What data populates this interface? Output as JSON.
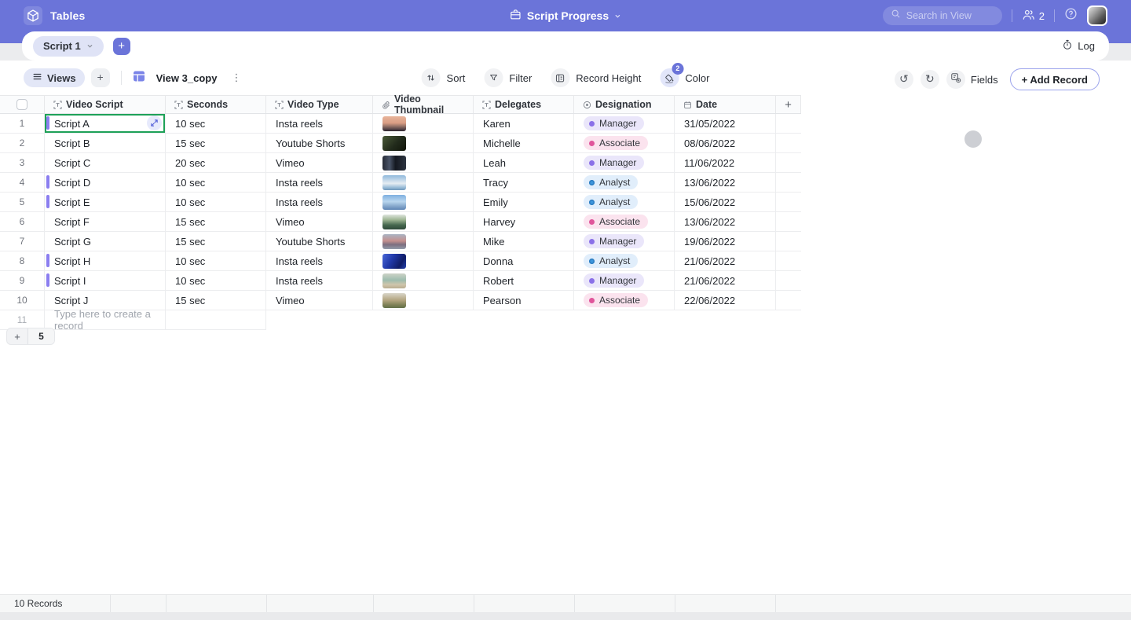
{
  "topbar": {
    "app_name": "Tables",
    "title": "Script Progress",
    "search_placeholder": "Search in View",
    "collaborator_count": "2"
  },
  "tabs": {
    "active_tab": "Script 1",
    "log_label": "Log"
  },
  "toolbar": {
    "views_label": "Views",
    "view_name": "View 3_copy",
    "sort_label": "Sort",
    "filter_label": "Filter",
    "record_height_label": "Record Height",
    "color_label": "Color",
    "color_badge": "2",
    "fields_label": "Fields",
    "add_record_label": "+ Add Record"
  },
  "table": {
    "columns": [
      {
        "label": "Video Script",
        "icon": "text-field-icon"
      },
      {
        "label": "Seconds",
        "icon": "text-field-icon"
      },
      {
        "label": "Video Type",
        "icon": "text-field-icon"
      },
      {
        "label": "Video Thumbnail",
        "icon": "attachment-icon"
      },
      {
        "label": "Delegates",
        "icon": "text-field-icon"
      },
      {
        "label": "Designation",
        "icon": "select-icon"
      },
      {
        "label": "Date",
        "icon": "date-icon"
      }
    ],
    "rows": [
      {
        "num": "1",
        "script": "Script A",
        "seconds": "10 sec",
        "type": "Insta reels",
        "delegate": "Karen",
        "designation": "Manager",
        "date": "31/05/2022",
        "accent": true,
        "selected": true,
        "thumb": "thumb-1"
      },
      {
        "num": "2",
        "script": "Script B",
        "seconds": "15 sec",
        "type": "Youtube Shorts",
        "delegate": "Michelle",
        "designation": "Associate",
        "date": "08/06/2022",
        "accent": false,
        "selected": false,
        "thumb": "thumb-2"
      },
      {
        "num": "3",
        "script": "Script C",
        "seconds": "20 sec",
        "type": "Vimeo",
        "delegate": "Leah",
        "designation": "Manager",
        "date": "11/06/2022",
        "accent": false,
        "selected": false,
        "thumb": "thumb-3"
      },
      {
        "num": "4",
        "script": "Script D",
        "seconds": "10 sec",
        "type": "Insta reels",
        "delegate": "Tracy",
        "designation": "Analyst",
        "date": "13/06/2022",
        "accent": true,
        "selected": false,
        "thumb": "thumb-4"
      },
      {
        "num": "5",
        "script": "Script E",
        "seconds": "10 sec",
        "type": "Insta reels",
        "delegate": "Emily",
        "designation": "Analyst",
        "date": "15/06/2022",
        "accent": true,
        "selected": false,
        "thumb": "thumb-5"
      },
      {
        "num": "6",
        "script": "Script F",
        "seconds": "15 sec",
        "type": "Vimeo",
        "delegate": "Harvey",
        "designation": "Associate",
        "date": "13/06/2022",
        "accent": false,
        "selected": false,
        "thumb": "thumb-6"
      },
      {
        "num": "7",
        "script": "Script G",
        "seconds": "15 sec",
        "type": "Youtube Shorts",
        "delegate": "Mike",
        "designation": "Manager",
        "date": "19/06/2022",
        "accent": false,
        "selected": false,
        "thumb": "thumb-7"
      },
      {
        "num": "8",
        "script": "Script H",
        "seconds": "10 sec",
        "type": "Insta reels",
        "delegate": "Donna",
        "designation": "Analyst",
        "date": "21/06/2022",
        "accent": true,
        "selected": false,
        "thumb": "thumb-8"
      },
      {
        "num": "9",
        "script": "Script I",
        "seconds": "10 sec",
        "type": "Insta reels",
        "delegate": "Robert",
        "designation": "Manager",
        "date": "21/06/2022",
        "accent": true,
        "selected": false,
        "thumb": "thumb-9"
      },
      {
        "num": "10",
        "script": "Script J",
        "seconds": "15 sec",
        "type": "Vimeo",
        "delegate": "Pearson",
        "designation": "Associate",
        "date": "22/06/2022",
        "accent": false,
        "selected": false,
        "thumb": "thumb-10"
      }
    ],
    "new_row": {
      "num": "11",
      "placeholder": "Type here to create a record"
    },
    "add_rows_count": "5",
    "designation_colors": {
      "Manager": "purple",
      "Associate": "pink",
      "Analyst": "blue"
    }
  },
  "footer": {
    "record_count": "10 Records"
  },
  "colors": {
    "accent_purple": "#6b74d9",
    "row_accent": "#8b7ef0",
    "selected_cell_border": "#1ea158",
    "pill_manager_dot": "#8a70e8",
    "pill_associate_dot": "#e0559b",
    "pill_analyst_dot": "#3d96dc"
  }
}
